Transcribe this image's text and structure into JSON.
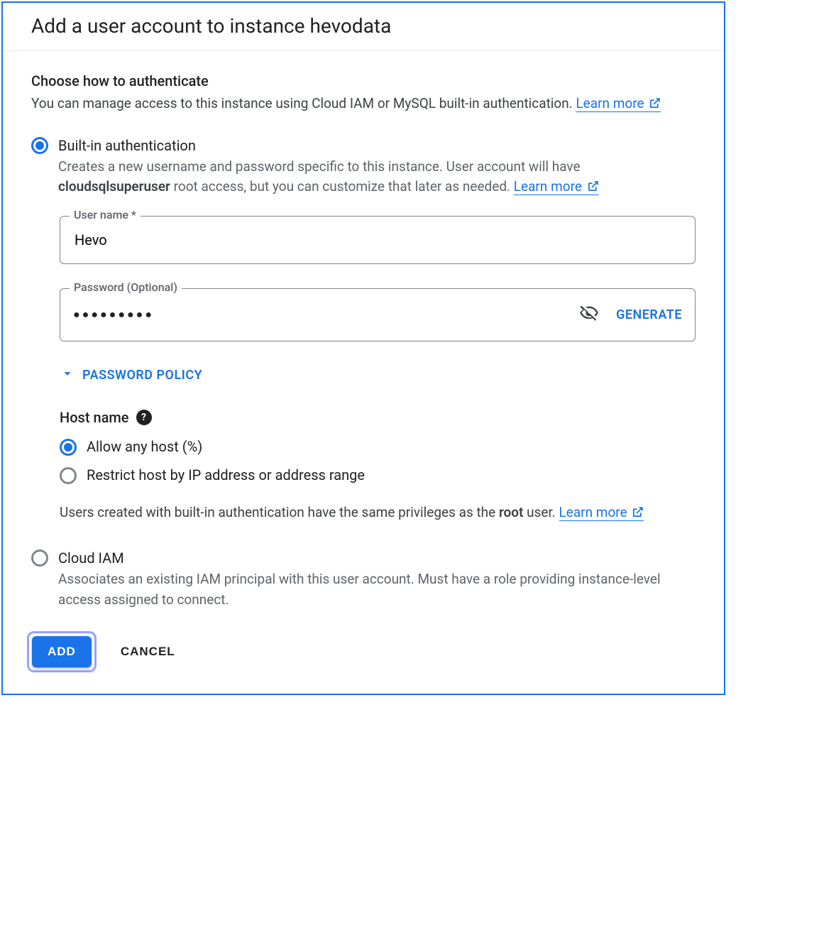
{
  "header": {
    "title": "Add a user account to instance hevodata"
  },
  "section": {
    "title": "Choose how to authenticate",
    "subtitle_pre": "You can manage access to this instance using Cloud IAM or MySQL built-in authentication. ",
    "learn_more": "Learn more"
  },
  "auth": {
    "builtin": {
      "label": "Built-in authentication",
      "desc_pre": "Creates a new username and password specific to this instance. User account will have ",
      "desc_role": "cloudsqlsuperuser",
      "desc_post": " root access, but you can customize that later as needed. ",
      "learn_more": "Learn more"
    },
    "cloudiam": {
      "label": "Cloud IAM",
      "desc": "Associates an existing IAM principal with this user account. Must have a role providing instance-level access assigned to connect."
    }
  },
  "form": {
    "username_label": "User name *",
    "username_value": "Hevo",
    "password_label": "Password (Optional)",
    "password_masked": "●●●●●●●●●",
    "generate": "GENERATE",
    "password_policy": "PASSWORD POLICY"
  },
  "host": {
    "label": "Host name",
    "allow_any": "Allow any host (%)",
    "restrict": "Restrict host by IP address or address range"
  },
  "note": {
    "pre": "Users created with built-in authentication have the same privileges as the ",
    "root": "root",
    "post": " user. ",
    "learn_more": "Learn more"
  },
  "footer": {
    "add": "ADD",
    "cancel": "CANCEL"
  }
}
